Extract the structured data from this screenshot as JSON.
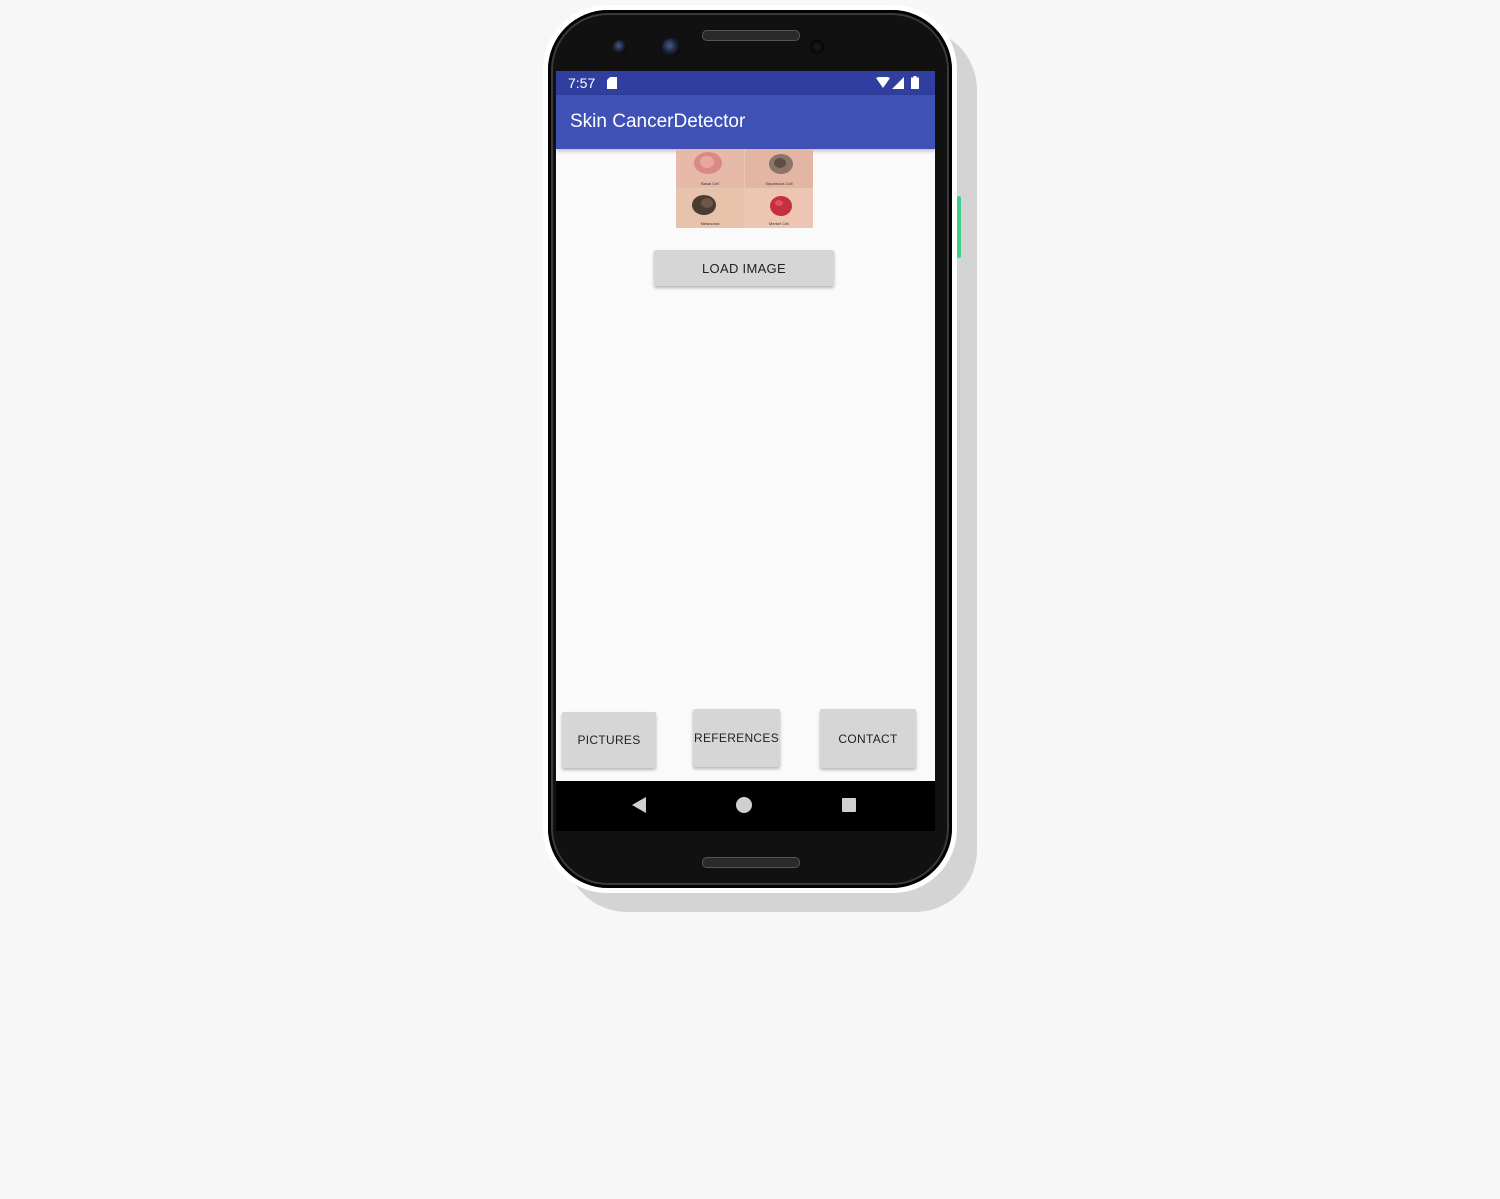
{
  "status_bar": {
    "time": "7:57",
    "icons": [
      "sd-card-icon",
      "wifi-icon",
      "signal-icon",
      "battery-icon"
    ]
  },
  "app_bar": {
    "title": "Skin CancerDetector"
  },
  "reference_image": {
    "captions": [
      "Basal Cell",
      "Squamous Cell",
      "Melanoma",
      "Merkel Cell"
    ]
  },
  "buttons": {
    "load_image": "LOAD IMAGE",
    "pictures": "PICTURES",
    "references": "REFERENCES",
    "contact": "CONTACT"
  },
  "nav_bar": {
    "icons": [
      "back-icon",
      "home-icon",
      "recent-apps-icon"
    ]
  },
  "colors": {
    "status_bar": "#303f9f",
    "app_bar": "#3f51b5",
    "button": "#d6d6d6",
    "background": "#fafafa"
  }
}
